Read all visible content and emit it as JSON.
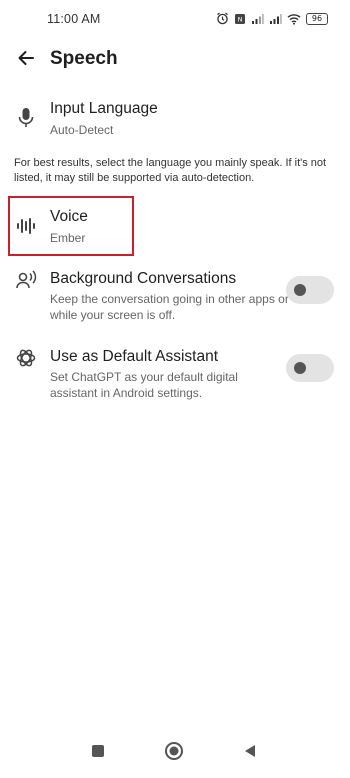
{
  "status_bar": {
    "time": "11:00 AM",
    "battery": "96",
    "icons": [
      "alarm-icon",
      "sim-icon",
      "signal-icon",
      "signal-icon",
      "wifi-icon",
      "battery-icon"
    ]
  },
  "header": {
    "title": "Speech",
    "back_icon": "arrow-left-icon"
  },
  "settings": {
    "input_language": {
      "title": "Input Language",
      "subtitle": "Auto-Detect",
      "icon": "microphone-icon"
    },
    "note": "For best results, select the language you mainly speak. If it's not listed, it may still be supported via auto-detection.",
    "voice": {
      "title": "Voice",
      "subtitle": "Ember",
      "icon": "waveform-icon"
    },
    "background_conversations": {
      "title": "Background Conversations",
      "subtitle": "Keep the conversation going in other apps or while your screen is off.",
      "icon": "person-sound-icon",
      "enabled": false
    },
    "default_assistant": {
      "title": "Use as Default Assistant",
      "subtitle": "Set ChatGPT as your default digital assistant in Android settings.",
      "icon": "openai-logo-icon",
      "enabled": false
    }
  },
  "colors": {
    "highlight": "#c8202e",
    "toggle_track": "#e3e3e3",
    "toggle_knob": "#555555"
  },
  "nav_bar": {
    "icons": [
      "square-icon",
      "home-circle-icon",
      "back-triangle-icon"
    ]
  }
}
